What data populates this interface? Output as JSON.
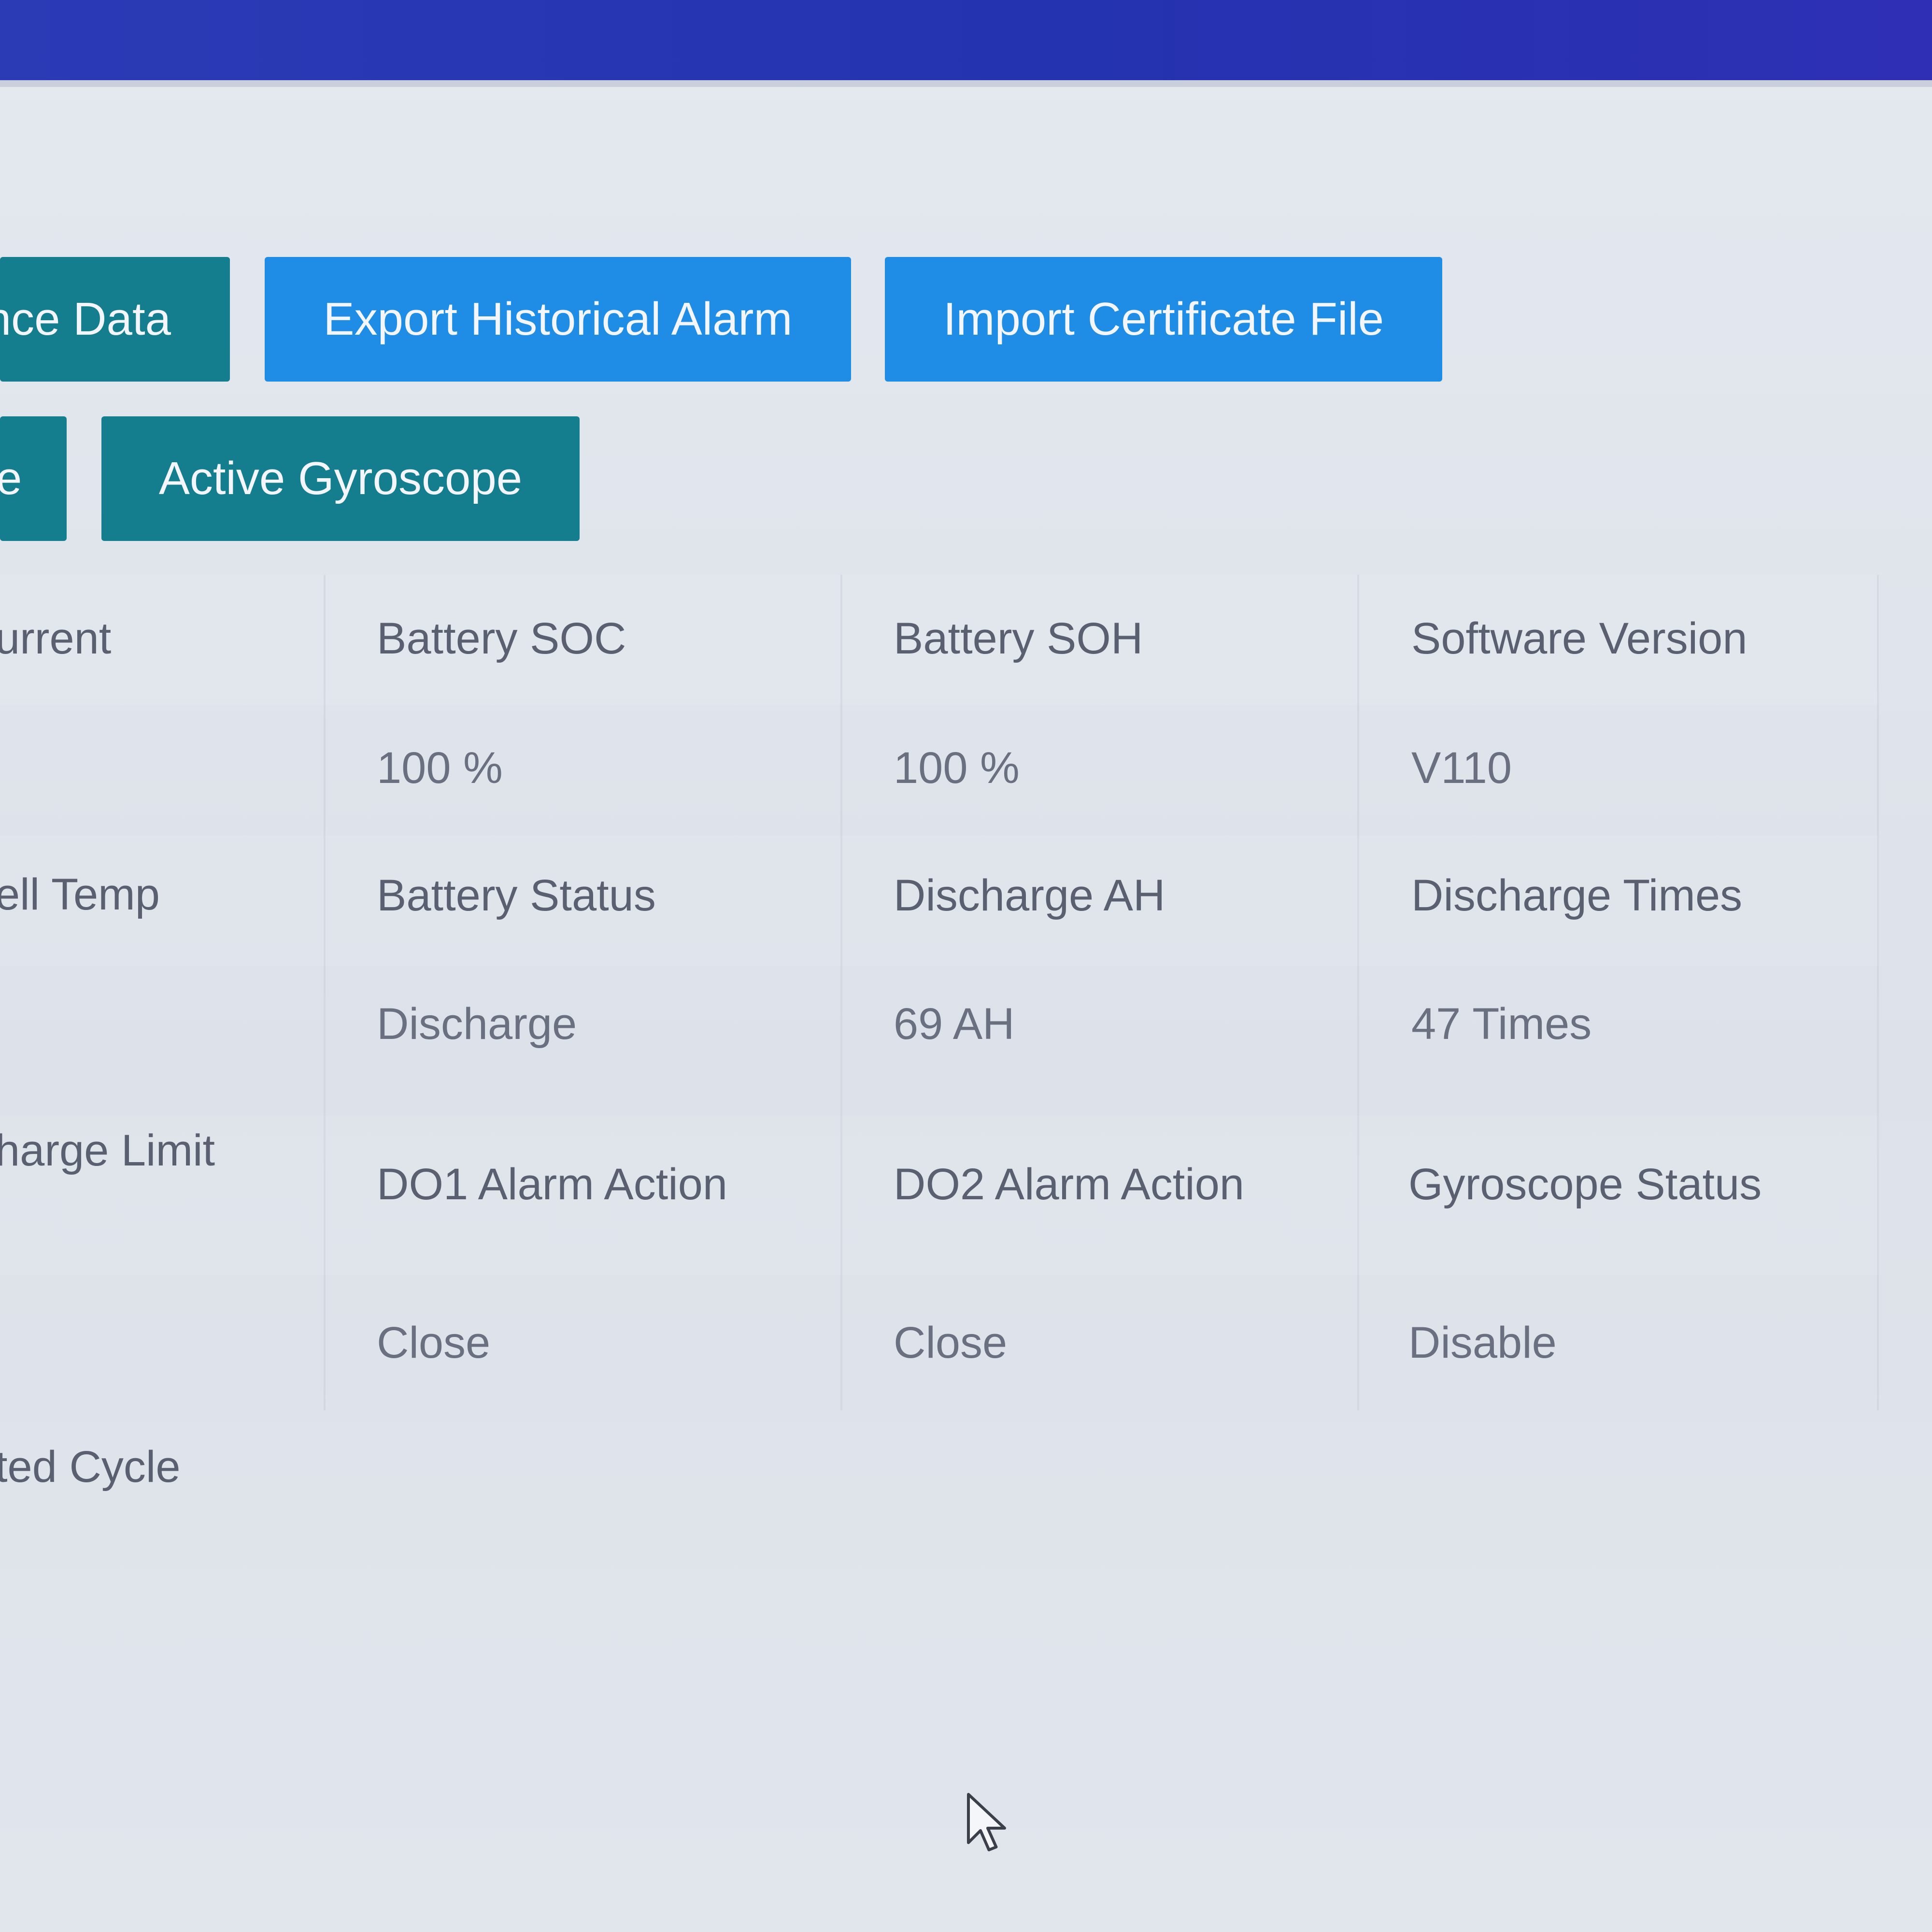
{
  "toolbar": {
    "row1": {
      "maintenance_data_label": "nce Data",
      "export_alarm_label": "Export Historical Alarm",
      "import_cert_label": "Import Certificate File"
    },
    "row2": {
      "partial_label": "e",
      "active_gyroscope_label": "Active Gyroscope"
    }
  },
  "info_grid": {
    "col0": {
      "r1_label": "urrent",
      "r2_label": "ell Temp",
      "r3_label": "harge Limit",
      "r4_label": "ted Cycle"
    },
    "col1": {
      "r1_label": "Battery SOC",
      "r1_value": "100 %",
      "r2_label": "Battery Status",
      "r2_value": "Discharge",
      "r3_label": "DO1 Alarm Action",
      "r3_value": "Close"
    },
    "col2": {
      "r1_label": "Battery SOH",
      "r1_value": "100 %",
      "r2_label": "Discharge AH",
      "r2_value": "69 AH",
      "r3_label": "DO2 Alarm Action",
      "r3_value": "Close"
    },
    "col3": {
      "r1_label": "Software Version",
      "r1_value": "V110",
      "r2_label": "Discharge Times",
      "r2_value": "47 Times",
      "r3_label": "Gyroscope Status",
      "r3_value": "Disable"
    }
  },
  "colors": {
    "header_bar": "#2b3bb6",
    "button_teal": "#147e8e",
    "button_blue": "#1f8de6"
  },
  "icons": {
    "cursor": "mouse-pointer-icon"
  }
}
